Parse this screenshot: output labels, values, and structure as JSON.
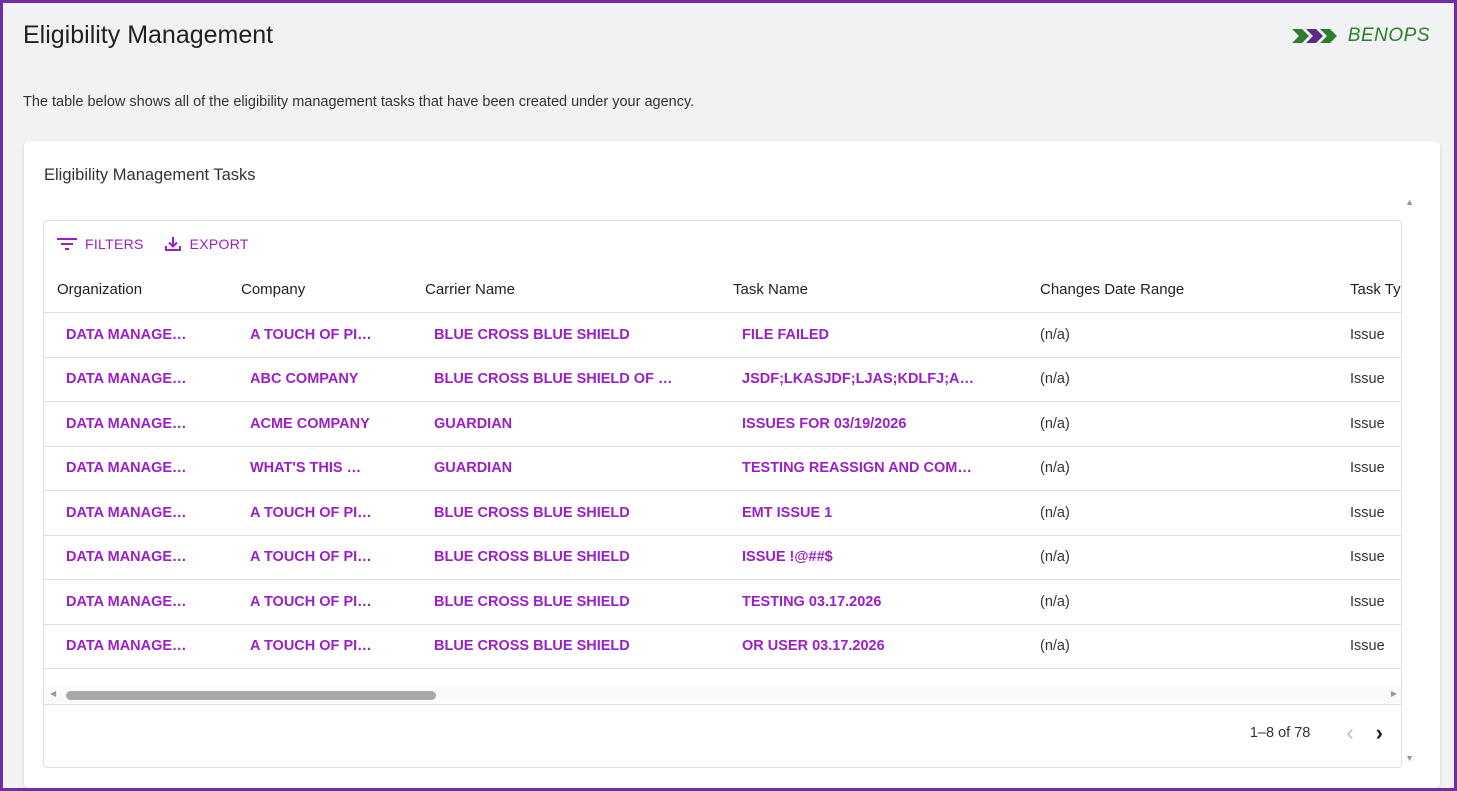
{
  "header": {
    "title": "Eligibility Management",
    "logo_text": "BENOPS",
    "description": "The table below shows all of the eligibility management tasks that have been created under your agency."
  },
  "card": {
    "title": "Eligibility Management Tasks"
  },
  "toolbar": {
    "filters_label": "FILTERS",
    "export_label": "EXPORT"
  },
  "table": {
    "columns": [
      "Organization",
      "Company",
      "Carrier Name",
      "Task Name",
      "Changes Date Range",
      "Task Ty"
    ],
    "rows": [
      [
        "DATA MANAGE…",
        "A TOUCH OF PI…",
        "BLUE CROSS BLUE SHIELD",
        "FILE FAILED",
        "(n/a)",
        "Issue"
      ],
      [
        "DATA MANAGE…",
        "ABC COMPANY",
        "BLUE CROSS BLUE SHIELD OF …",
        "JSDF;LKASJDF;LJAS;KDLFJ;A…",
        "(n/a)",
        "Issue"
      ],
      [
        "DATA MANAGE…",
        "ACME COMPANY",
        "GUARDIAN",
        "ISSUES FOR 03/19/2026",
        "(n/a)",
        "Issue"
      ],
      [
        "DATA MANAGE…",
        "WHAT'S THIS …",
        "GUARDIAN",
        "TESTING REASSIGN AND COM…",
        "(n/a)",
        "Issue"
      ],
      [
        "DATA MANAGE…",
        "A TOUCH OF PI…",
        "BLUE CROSS BLUE SHIELD",
        "EMT ISSUE 1",
        "(n/a)",
        "Issue"
      ],
      [
        "DATA MANAGE…",
        "A TOUCH OF PI…",
        "BLUE CROSS BLUE SHIELD",
        "ISSUE !@##$",
        "(n/a)",
        "Issue"
      ],
      [
        "DATA MANAGE…",
        "A TOUCH OF PI…",
        "BLUE CROSS BLUE SHIELD",
        "TESTING 03.17.2026",
        "(n/a)",
        "Issue"
      ],
      [
        "DATA MANAGE…",
        "A TOUCH OF PI…",
        "BLUE CROSS BLUE SHIELD",
        "OR USER 03.17.2026",
        "(n/a)",
        "Issue"
      ]
    ]
  },
  "pagination": {
    "range_text": "1–8 of 78"
  },
  "icons": {
    "filters": "filter-lines-icon",
    "export": "download-icon",
    "prev": "chevron-left-icon",
    "next": "chevron-right-icon"
  },
  "colors": {
    "frame_border": "#6f2da8",
    "accent": "#9b1fc6",
    "logo_green": "#2f7d2a"
  }
}
